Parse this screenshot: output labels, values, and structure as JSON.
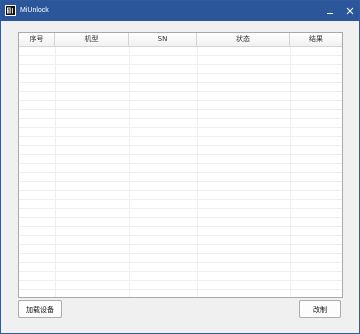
{
  "window": {
    "title": "MiUnlock",
    "minimize_label": "_",
    "close_label": "✕",
    "accent": "#2b579a"
  },
  "table": {
    "columns": [
      "序号",
      "机型",
      "SN",
      "状态",
      "结果"
    ],
    "rows": []
  },
  "buttons": {
    "load_devices": "加载设备",
    "unlock": "改制"
  }
}
